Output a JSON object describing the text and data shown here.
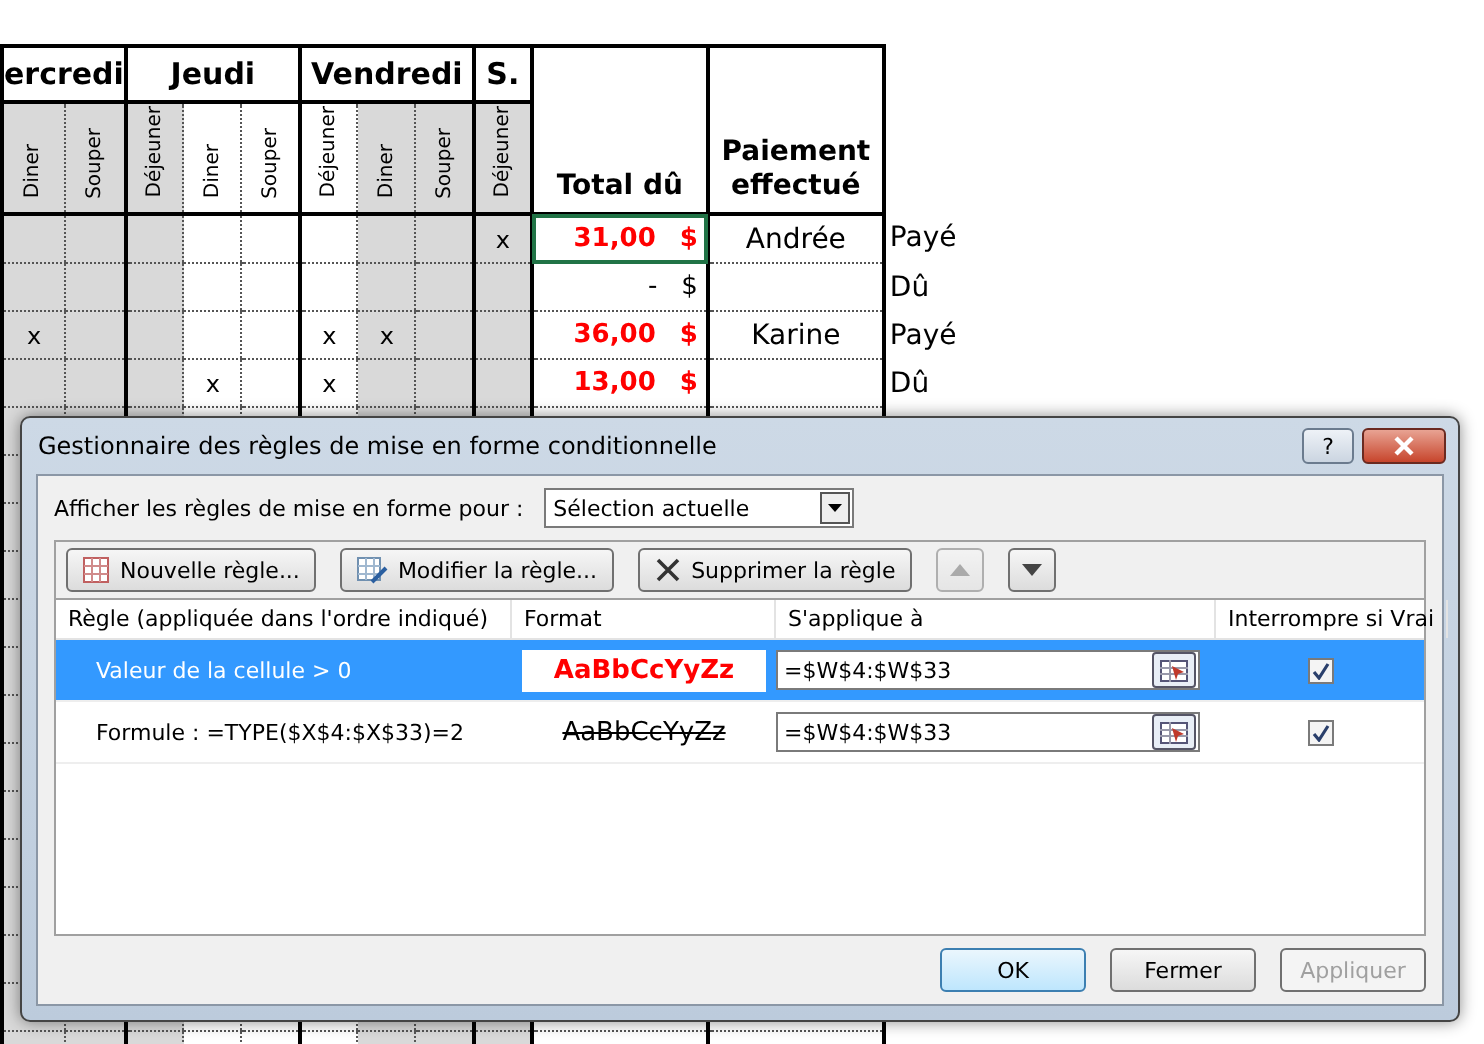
{
  "sheet": {
    "day_groups": [
      {
        "label": "ercredi",
        "columns": [
          {
            "label": "Diner",
            "shaded": true
          },
          {
            "label": "Souper",
            "shaded": true
          }
        ]
      },
      {
        "label": "Jeudi",
        "columns": [
          {
            "label": "Déjeuner",
            "shaded": true
          },
          {
            "label": "Diner",
            "shaded": false
          },
          {
            "label": "Souper",
            "shaded": false
          }
        ]
      },
      {
        "label": "Vendredi",
        "columns": [
          {
            "label": "Déjeuner",
            "shaded": false
          },
          {
            "label": "Diner",
            "shaded": true
          },
          {
            "label": "Souper",
            "shaded": true
          }
        ]
      },
      {
        "label": "S.",
        "columns": [
          {
            "label": "Déjeuner",
            "shaded": true
          }
        ]
      }
    ],
    "total_header": "Total dû",
    "payment_header": "Paiement effectué",
    "rows": [
      {
        "cells": [
          {},
          {},
          {},
          {},
          {},
          {},
          {},
          {},
          {
            "mark": "x"
          }
        ],
        "total": "31,00",
        "currency": "$",
        "flagged": true,
        "selected": true,
        "payment": "Andrée",
        "status": "Payé"
      },
      {
        "cells": [
          {},
          {},
          {},
          {},
          {},
          {},
          {},
          {},
          {}
        ],
        "total": "-",
        "currency": "$",
        "flagged": false,
        "selected": false,
        "status": "Dû"
      },
      {
        "cells": [
          {
            "mark": "x"
          },
          {},
          {},
          {},
          {},
          {
            "mark": "x"
          },
          {
            "mark": "x"
          },
          {},
          {}
        ],
        "total": "36,00",
        "currency": "$",
        "flagged": true,
        "selected": false,
        "payment": "Karine",
        "status": "Payé"
      },
      {
        "cells": [
          {},
          {},
          {},
          {
            "mark": "x"
          },
          {},
          {
            "mark": "x"
          },
          {},
          {},
          {}
        ],
        "total": "13,00",
        "currency": "$",
        "flagged": true,
        "selected": false,
        "status": "Dû"
      }
    ]
  },
  "dialog": {
    "title": "Gestionnaire des règles de mise en forme conditionnelle",
    "help_button": "?",
    "show_for": {
      "label": "Afficher les règles de mise en forme pour :",
      "value": "Sélection actuelle"
    },
    "toolbar": [
      {
        "kind": "new",
        "label": "Nouvelle règle...",
        "disabled": false
      },
      {
        "kind": "edit",
        "label": "Modifier la règle...",
        "disabled": false
      },
      {
        "kind": "delete",
        "label": "Supprimer la règle",
        "disabled": false
      },
      {
        "kind": "up",
        "disabled": true
      },
      {
        "kind": "down",
        "disabled": false
      }
    ],
    "columns": [
      "Règle (appliquée dans l'ordre indiqué)",
      "Format",
      "S'applique à",
      "Interrompre si Vrai"
    ],
    "rules": [
      {
        "rule": "Valeur de la cellule > 0",
        "format": "AaBbCcYyZz",
        "bold": true,
        "strikethrough": false,
        "color": "#ff0000",
        "applies_to": "=$W$4:$W$33",
        "stop_if_true": true,
        "selected": true
      },
      {
        "rule": "Formule : =TYPE($X$4:$X$33)=2",
        "format": "AaBbCcYyZz",
        "bold": false,
        "strikethrough": true,
        "color": "#000000",
        "applies_to": "=$W$4:$W$33",
        "stop_if_true": true,
        "selected": false
      }
    ],
    "buttons": [
      {
        "label": "OK",
        "kind": "default",
        "disabled": false
      },
      {
        "label": "Fermer",
        "kind": "normal",
        "disabled": false
      },
      {
        "label": "Appliquer",
        "kind": "normal",
        "disabled": true
      }
    ]
  }
}
